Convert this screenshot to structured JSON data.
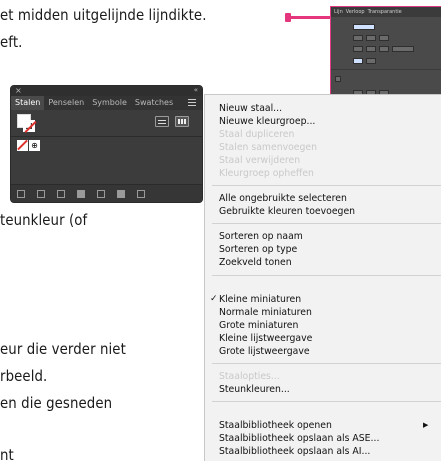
{
  "document": {
    "lines": [
      "et midden uitgelijnde lijndikte.",
      "eft.",
      "teunkleur (of",
      "eur die verder niet",
      "rbeeld.",
      "en die gesneden",
      "nt"
    ]
  },
  "swatches_panel": {
    "close": "×",
    "collapse": "«",
    "tabs": [
      "Stalen",
      "Penselen",
      "Symbole",
      "Swatches"
    ],
    "registration_glyph": "⊕"
  },
  "stroke_panel": {
    "tabs": [
      "Lijn",
      "Verloop",
      "Transparantie"
    ]
  },
  "menu": {
    "items": [
      {
        "label": "Nieuw staal...",
        "enabled": true
      },
      {
        "label": "Nieuwe kleurgroep...",
        "enabled": true
      },
      {
        "label": "Staal dupliceren",
        "enabled": false
      },
      {
        "label": "Stalen samenvoegen",
        "enabled": false
      },
      {
        "label": "Staal verwijderen",
        "enabled": false
      },
      {
        "label": "Kleurgroep opheffen",
        "enabled": false
      },
      {
        "label": "Alle ongebruikte selecteren",
        "enabled": true
      },
      {
        "label": "Gebruikte kleuren toevoegen",
        "enabled": true
      },
      {
        "label": "Sorteren op naam",
        "enabled": true
      },
      {
        "label": "Sorteren op type",
        "enabled": true
      },
      {
        "label": "Zoekveld tonen",
        "enabled": true
      },
      {
        "label": "Kleine miniaturen",
        "enabled": true,
        "checked": true
      },
      {
        "label": "Normale miniaturen",
        "enabled": true
      },
      {
        "label": "Grote miniaturen",
        "enabled": true
      },
      {
        "label": "Kleine lijstweergave",
        "enabled": true
      },
      {
        "label": "Grote lijstweergave",
        "enabled": true
      },
      {
        "label": "Staalopties...",
        "enabled": false
      },
      {
        "label": "Steunkleuren...",
        "enabled": true
      },
      {
        "label": "Staalbibliotheek openen",
        "enabled": true,
        "submenu": true
      },
      {
        "label": "Staalbibliotheek opslaan als ASE...",
        "enabled": true
      },
      {
        "label": "Staalbibliotheek opslaan als AI...",
        "enabled": true
      }
    ],
    "check_glyph": "✓",
    "submenu_glyph": "▶"
  },
  "colors": {
    "accent_pink": "#e5367d",
    "panel_dark": "#3c3c3c",
    "menu_bg": "#f2f2f2",
    "none_red": "#e0312b"
  }
}
